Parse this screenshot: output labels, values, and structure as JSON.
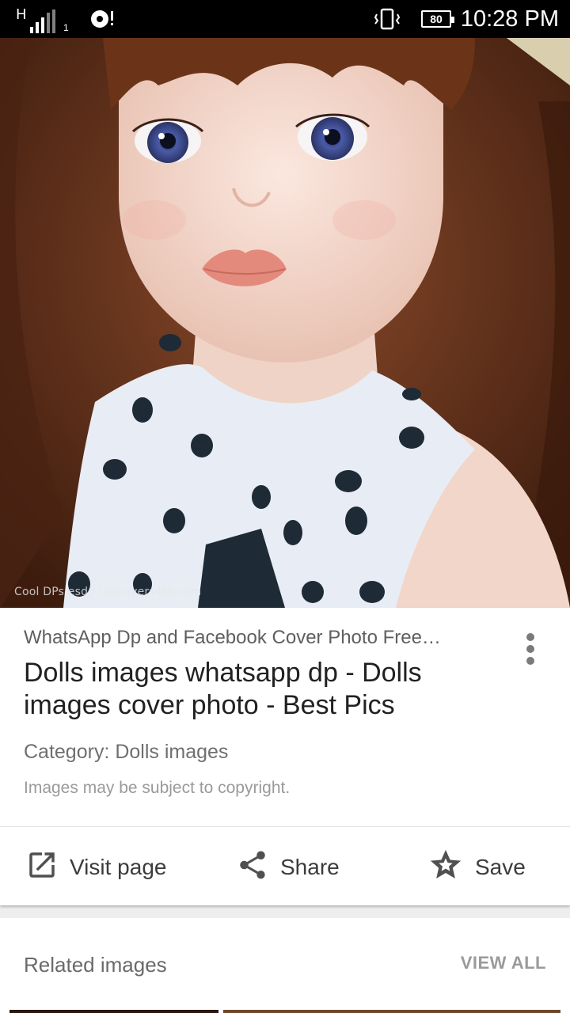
{
  "status_bar": {
    "network": "H",
    "sim_slot": "1",
    "battery": "80",
    "time": "10:28 PM"
  },
  "image": {
    "watermark": "Cool DPs esdp.topcovers4fb.com"
  },
  "result": {
    "source": "WhatsApp Dp and Facebook Cover Photo Free…",
    "title": "Dolls images whatsapp dp - Dolls images cover photo - Best Pics",
    "category": "Category: Dolls images",
    "copyright": "Images may be subject to copyright."
  },
  "actions": {
    "visit": "Visit page",
    "share": "Share",
    "save": "Save"
  },
  "related": {
    "title": "Related images",
    "view_all": "VIEW ALL"
  },
  "icons": [
    "signal-icon",
    "download-icon",
    "vibrate-icon",
    "battery-icon",
    "more-vert-icon",
    "open-in-new-icon",
    "share-icon",
    "star-icon"
  ]
}
